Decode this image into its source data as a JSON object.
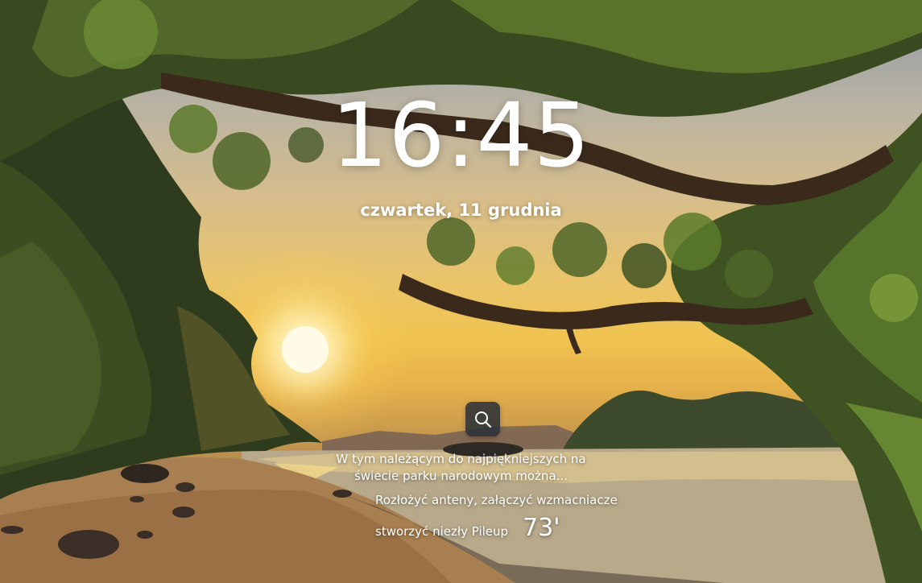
{
  "lockscreen": {
    "time": "16:45",
    "date": "czwartek, 11 grudnia",
    "search": {
      "icon": "search-icon"
    },
    "spotlight": {
      "title": "W tym należącym do najpiękniejszych na świecie parku narodowym można...",
      "line2": "Rozłożyć anteny, załączyć wzmacniacze",
      "line3": "stworzyć niezły Pileup",
      "temperature": "73'"
    }
  },
  "colors": {
    "text": "#ffffff",
    "search_button_bg": "#282e36"
  }
}
